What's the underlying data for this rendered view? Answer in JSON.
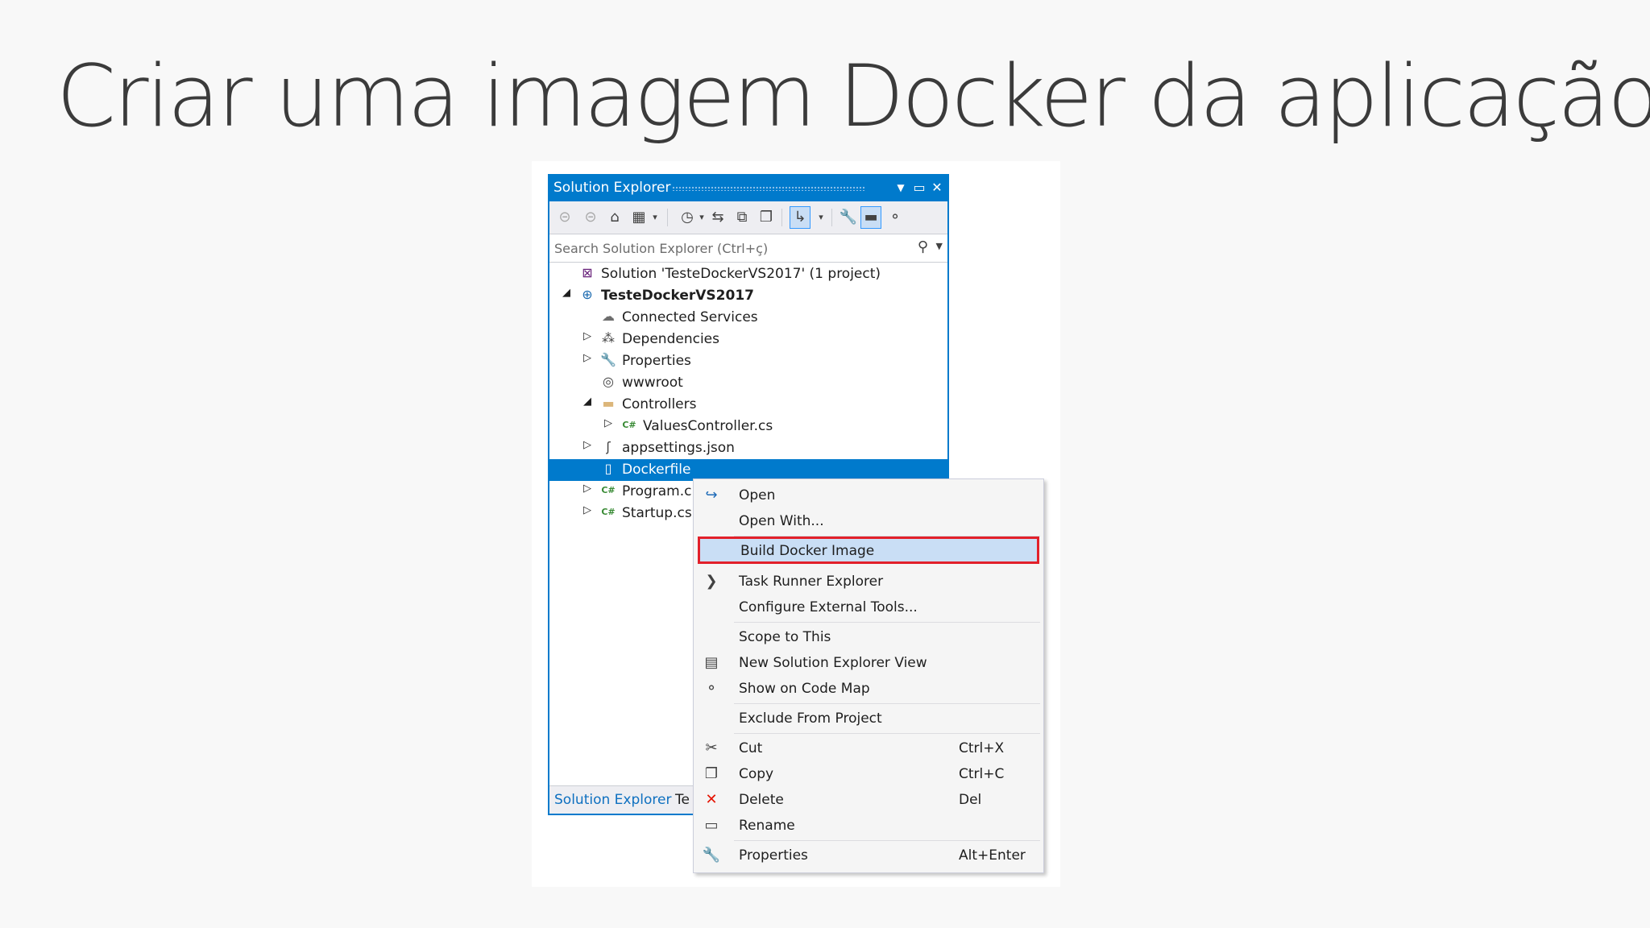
{
  "slide": {
    "title": "Criar uma imagem Docker da aplicação"
  },
  "panel": {
    "title": "Solution Explorer",
    "title_buttons": [
      "dropdown-arrow",
      "maximize",
      "close"
    ],
    "toolbar_icons": [
      "back-icon",
      "forward-icon",
      "home-icon",
      "switch-views-icon",
      "pending-changes-filter-icon",
      "sync-icon",
      "collapse-all-icon",
      "show-all-files-icon",
      "preview-selected-icon",
      "properties-icon",
      "pin-icon",
      "code-map-icon"
    ],
    "search_placeholder": "Search Solution Explorer (Ctrl+ç)",
    "tree": [
      {
        "label": "Solution 'TesteDockerVS2017' (1 project)",
        "icon": "solution-icon",
        "level": 0,
        "arrow": ""
      },
      {
        "label": "TesteDockerVS2017",
        "icon": "web-project-icon",
        "level": 0,
        "arrow": "expanded",
        "bold": true
      },
      {
        "label": "Connected Services",
        "icon": "connected-services-icon",
        "level": 1,
        "arrow": ""
      },
      {
        "label": "Dependencies",
        "icon": "dependencies-icon",
        "level": 1,
        "arrow": "collapsed"
      },
      {
        "label": "Properties",
        "icon": "wrench-icon",
        "level": 1,
        "arrow": "collapsed"
      },
      {
        "label": "wwwroot",
        "icon": "globe-icon",
        "level": 1,
        "arrow": ""
      },
      {
        "label": "Controllers",
        "icon": "folder-icon",
        "level": 1,
        "arrow": "expanded"
      },
      {
        "label": "ValuesController.cs",
        "icon": "csharp-file-icon",
        "level": 2,
        "arrow": "collapsed"
      },
      {
        "label": "appsettings.json",
        "icon": "json-file-icon",
        "level": 1,
        "arrow": "collapsed"
      },
      {
        "label": "Dockerfile",
        "icon": "file-icon",
        "level": 1,
        "arrow": "",
        "selected": true
      },
      {
        "label": "Program.c",
        "icon": "csharp-file-icon",
        "level": 1,
        "arrow": "collapsed"
      },
      {
        "label": "Startup.cs",
        "icon": "csharp-file-icon",
        "level": 1,
        "arrow": "collapsed"
      }
    ],
    "tabs": [
      "Solution Explorer",
      "Te"
    ]
  },
  "context_menu": {
    "items": [
      {
        "label": "Open",
        "icon": "open-arrow-icon",
        "shortcut": ""
      },
      {
        "label": "Open With...",
        "icon": "",
        "shortcut": ""
      },
      {
        "sep": true
      },
      {
        "label": "Build Docker Image",
        "icon": "",
        "shortcut": "",
        "highlighted": true
      },
      {
        "label": "Task Runner Explorer",
        "icon": "chevron-right-icon",
        "shortcut": ""
      },
      {
        "label": "Configure External Tools...",
        "icon": "",
        "shortcut": ""
      },
      {
        "sep": true
      },
      {
        "label": "Scope to This",
        "icon": "",
        "shortcut": ""
      },
      {
        "label": "New Solution Explorer View",
        "icon": "new-view-icon",
        "shortcut": ""
      },
      {
        "label": "Show on Code Map",
        "icon": "code-map-icon",
        "shortcut": ""
      },
      {
        "sep": true
      },
      {
        "label": "Exclude From Project",
        "icon": "",
        "shortcut": ""
      },
      {
        "sep": true
      },
      {
        "label": "Cut",
        "icon": "scissors-icon",
        "shortcut": "Ctrl+X"
      },
      {
        "label": "Copy",
        "icon": "copy-icon",
        "shortcut": "Ctrl+C"
      },
      {
        "label": "Delete",
        "icon": "delete-x-icon",
        "shortcut": "Del"
      },
      {
        "label": "Rename",
        "icon": "rename-icon",
        "shortcut": ""
      },
      {
        "sep": true
      },
      {
        "label": "Properties",
        "icon": "wrench-icon",
        "shortcut": "Alt+Enter"
      }
    ]
  },
  "colors": {
    "accent": "#007acc",
    "highlight": "#c9def5",
    "highlight_border": "#e2202a",
    "delete": "#e51400"
  }
}
